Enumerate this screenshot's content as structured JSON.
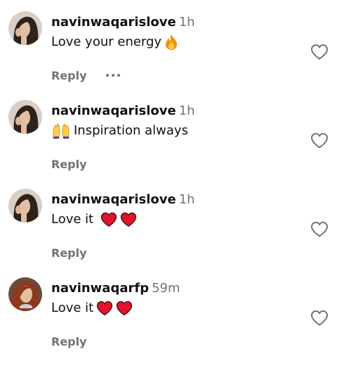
{
  "comments": [
    {
      "username": "navinwaqarislove",
      "time": "1h",
      "text": "Love your energy",
      "emojis": [
        "fire"
      ],
      "emoji_position": "after",
      "reply_label": "Reply",
      "has_more": true,
      "avatar": "woman-portrait-dark-hair"
    },
    {
      "username": "navinwaqarislove",
      "time": "1h",
      "text": "Inspiration always",
      "emojis": [
        "raising-hands"
      ],
      "emoji_position": "before",
      "reply_label": "Reply",
      "has_more": false,
      "avatar": "woman-portrait-dark-hair"
    },
    {
      "username": "navinwaqarislove",
      "time": "1h",
      "text": "Love it",
      "emojis": [
        "red-heart",
        "red-heart"
      ],
      "emoji_position": "after",
      "reply_label": "Reply",
      "has_more": false,
      "avatar": "woman-portrait-dark-hair"
    },
    {
      "username": "navinwaqarfp",
      "time": "59m",
      "text": "Love it",
      "emojis": [
        "red-heart",
        "red-heart"
      ],
      "emoji_position": "after-tight",
      "reply_label": "Reply",
      "has_more": false,
      "avatar": "woman-portrait-red-hair"
    }
  ],
  "icons": {
    "like": "heart-outline-icon",
    "more": "ellipsis-icon"
  },
  "colors": {
    "text": "#111111",
    "secondary": "#737373",
    "heart_emoji": "#e0142a",
    "fire_emoji": "#f4900c"
  }
}
